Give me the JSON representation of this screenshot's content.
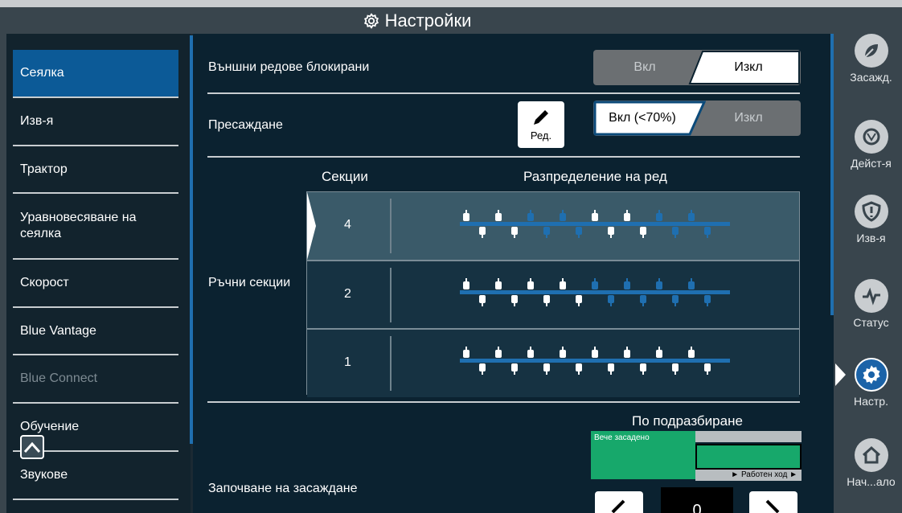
{
  "title": "Настройки",
  "sidebar": {
    "items": [
      {
        "label": "Сеялка",
        "state": "active"
      },
      {
        "label": "Изв-я",
        "state": "normal"
      },
      {
        "label": "Трактор",
        "state": "normal"
      },
      {
        "label": "Уравновесяване на сеялка",
        "state": "normal"
      },
      {
        "label": "Скорост",
        "state": "normal"
      },
      {
        "label": "Blue Vantage",
        "state": "normal"
      },
      {
        "label": "Blue Connect",
        "state": "disabled"
      },
      {
        "label": "Обучение",
        "state": "normal"
      },
      {
        "label": "Звукове",
        "state": "normal"
      }
    ]
  },
  "settings": {
    "outer_rows_locked": {
      "label": "Външни редове блокирани",
      "on_label": "Вкл",
      "off_label": "Изкл",
      "selected": "off"
    },
    "replant": {
      "label": "Пресаждане",
      "edit_label": "Ред.",
      "on_label": "Вкл (<70%)",
      "off_label": "Изкл",
      "selected": "on"
    },
    "manual_sections": {
      "label": "Ръчни секции",
      "col_sections": "Секции",
      "col_distribution": "Разпределение на ред",
      "rows": [
        {
          "sections": "4",
          "selected": true,
          "highlight_units": [
            [
              0,
              4
            ],
            [
              8,
              12
            ]
          ],
          "total_units": 16
        },
        {
          "sections": "2",
          "selected": false,
          "highlight_units": [
            [
              0,
              8
            ]
          ],
          "total_units": 16
        },
        {
          "sections": "1",
          "selected": false,
          "highlight_units": [
            [
              0,
              16
            ]
          ],
          "total_units": 16
        }
      ]
    },
    "planting_start": {
      "label": "Започване на засаждане",
      "default_title": "По подразбиране",
      "already_planted": "Вече засадено",
      "working_travel": "► Работен ход ►",
      "value": "0"
    }
  },
  "rail": {
    "items": [
      {
        "label": "Засажд.",
        "icon": "planting-icon",
        "active": false
      },
      {
        "label": "Дейст-я",
        "icon": "operations-icon",
        "active": false
      },
      {
        "label": "Изв-я",
        "icon": "alerts-shield-icon",
        "active": false
      },
      {
        "label": "Статус",
        "icon": "status-pulse-icon",
        "active": false
      },
      {
        "label": "Настр.",
        "icon": "settings-gear-icon",
        "active": true
      },
      {
        "label": "Нач...ало",
        "icon": "home-icon",
        "active": false
      }
    ]
  },
  "colors": {
    "accent": "#0c5a97",
    "active_seed": "#ffffff",
    "inactive_seed": "#1f6fb0",
    "green": "#17a86b"
  }
}
